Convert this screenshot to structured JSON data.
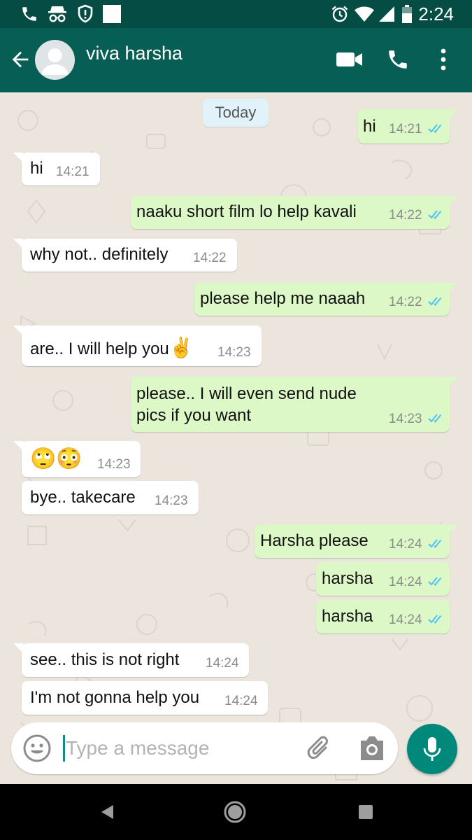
{
  "status_bar": {
    "time": "2:24",
    "icons": [
      "phone-icon",
      "incognito-icon",
      "shield-alert-icon",
      "square-notification-icon",
      "alarm-icon",
      "wifi-icon",
      "cell-signal-icon",
      "battery-icon"
    ]
  },
  "header": {
    "contact_name": "viva harsha",
    "icons": [
      "back-arrow-icon",
      "avatar-placeholder-icon",
      "video-call-icon",
      "voice-call-icon",
      "more-vert-icon"
    ]
  },
  "chat": {
    "date_chip": "Today",
    "messages": [
      {
        "direction": "out",
        "text": "hi",
        "time": "14:21",
        "status": "read"
      },
      {
        "direction": "in",
        "text": "hi",
        "time": "14:21"
      },
      {
        "direction": "out",
        "text": "naaku short film lo help kavali",
        "time": "14:22",
        "status": "read"
      },
      {
        "direction": "in",
        "text": "why not.. definitely",
        "time": "14:22"
      },
      {
        "direction": "out",
        "text": "please help me naaah",
        "time": "14:22",
        "status": "read"
      },
      {
        "direction": "in",
        "text": "are.. I will help you",
        "emoji": "✌️",
        "time": "14:23"
      },
      {
        "direction": "out",
        "text": "please.. I will even send nude",
        "text2": "pics if you want",
        "time": "14:23",
        "status": "read"
      },
      {
        "direction": "in",
        "emoji": "🙄😳",
        "time": "14:23"
      },
      {
        "direction": "in",
        "text": "bye.. takecare",
        "time": "14:23"
      },
      {
        "direction": "out",
        "text": "Harsha please",
        "time": "14:24",
        "status": "read"
      },
      {
        "direction": "out",
        "text": "harsha",
        "time": "14:24",
        "status": "read"
      },
      {
        "direction": "out",
        "text": "harsha",
        "time": "14:24",
        "status": "read"
      },
      {
        "direction": "in",
        "text": "see.. this is not right",
        "time": "14:24"
      },
      {
        "direction": "in",
        "text": "I'm not gonna help you",
        "time": "14:24"
      }
    ]
  },
  "composer": {
    "placeholder": "Type a message",
    "value": "",
    "icons": [
      "emoji-icon",
      "attach-icon",
      "camera-icon",
      "mic-icon"
    ]
  },
  "nav_bar": {
    "icons": [
      "back-triangle-icon",
      "home-circle-icon",
      "recents-square-icon"
    ]
  },
  "colors": {
    "header": "#075e54",
    "status_bar": "#054d44",
    "outgoing_bubble": "#dcf8c6",
    "incoming_bubble": "#ffffff",
    "read_ticks": "#4fc3f7",
    "mic_button": "#00897b",
    "chat_background": "#ece5dd"
  }
}
